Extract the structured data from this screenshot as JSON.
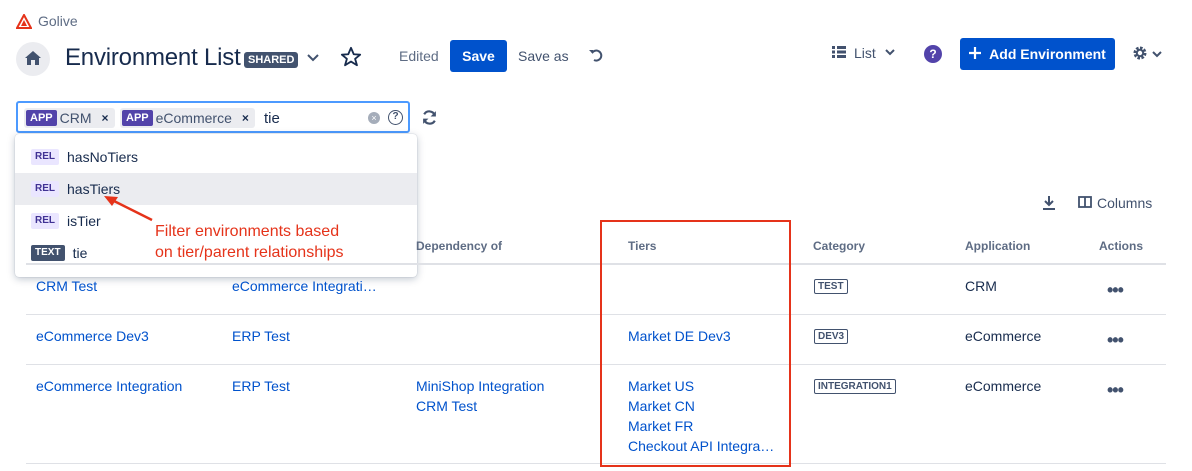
{
  "app": {
    "name": "Golive",
    "brand_color": "#e5331a"
  },
  "header": {
    "title": "Environment List",
    "badge": "SHARED",
    "edited": "Edited",
    "save": "Save",
    "save_as": "Save as",
    "view": "List",
    "help": "?",
    "add": "Add Environment"
  },
  "filter": {
    "chips": [
      {
        "kind": "APP",
        "label": "CRM"
      },
      {
        "kind": "APP",
        "label": "eCommerce"
      }
    ],
    "query": "tie",
    "remove_glyph": "×"
  },
  "dropdown": {
    "items": [
      {
        "tag": "REL",
        "label": "hasNoTiers"
      },
      {
        "tag": "REL",
        "label": "hasTiers"
      },
      {
        "tag": "REL",
        "label": "isTier"
      },
      {
        "tag": "TEXT",
        "label": "tie"
      }
    ]
  },
  "annotation": {
    "line1": "Filter environments based",
    "line2": "on tier/parent relationships"
  },
  "toolbar": {
    "columns": "Columns"
  },
  "table": {
    "headers": {
      "dependency_of": "Dependency of",
      "tiers": "Tiers",
      "category": "Category",
      "application": "Application",
      "actions": "Actions"
    },
    "rows": [
      {
        "name": "CRM Test",
        "parent": "eCommerce Integrati…",
        "dependency_of": [],
        "tiers": [],
        "category": "TEST",
        "application": "CRM",
        "more": "•••"
      },
      {
        "name": "eCommerce Dev3",
        "parent": "ERP Test",
        "dependency_of": [],
        "tiers": [
          "Market DE Dev3"
        ],
        "category": "DEV3",
        "application": "eCommerce",
        "more": "•••"
      },
      {
        "name": "eCommerce Integration",
        "parent": "ERP Test",
        "dependency_of": [
          "MiniShop Integration",
          "CRM Test"
        ],
        "tiers": [
          "Market US",
          "Market CN",
          "Market FR",
          "Checkout API Integra…"
        ],
        "category": "INTEGRATION1",
        "application": "eCommerce",
        "more": "•••"
      }
    ]
  }
}
